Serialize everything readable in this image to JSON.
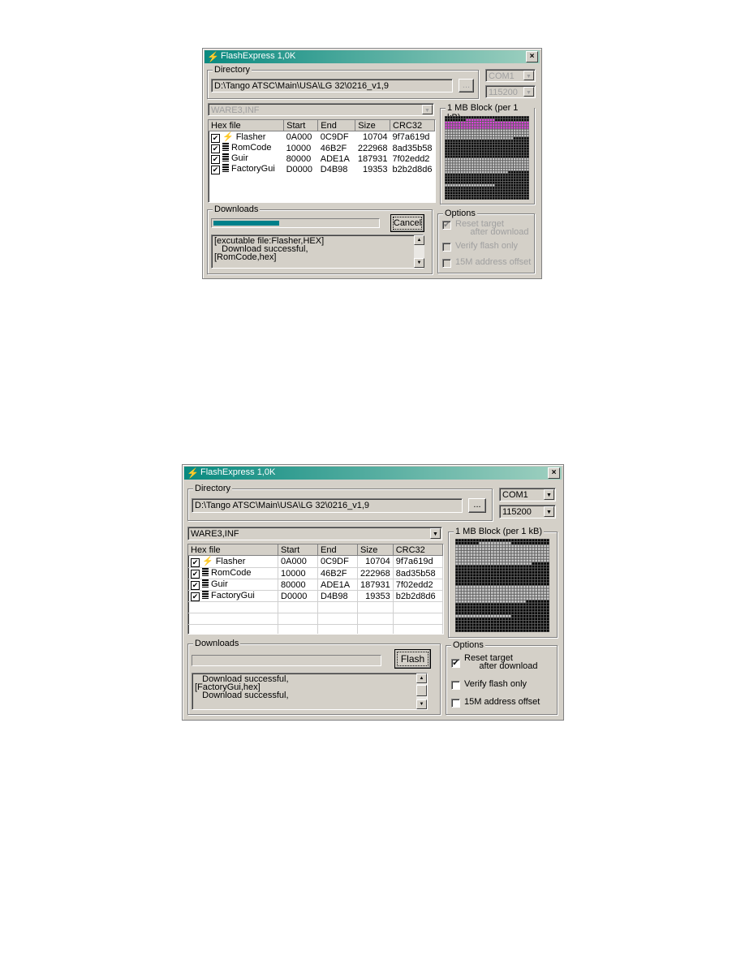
{
  "windows": [
    {
      "title": "FlashExpress 1,0K",
      "directory_label": "Directory",
      "directory_path": "D:\\Tango ATSC\\Main\\USA\\LG 32\\0216_v1,9",
      "browse_label": "...",
      "port": "COM1",
      "baud": "115200",
      "port_enabled": false,
      "inf_file": "WARE3,INF",
      "columns": [
        "Hex file",
        "Start",
        "End",
        "Size",
        "CRC32"
      ],
      "files": [
        {
          "name": "Flasher",
          "icon": "bolt-icon",
          "checked": true,
          "start": "0A000",
          "end": "0C9DF",
          "size": "10704",
          "crc": "9f7a619d"
        },
        {
          "name": "RomCode",
          "icon": "chip-icon",
          "checked": true,
          "start": "10000",
          "end": "46B2F",
          "size": "222968",
          "crc": "8ad35b58"
        },
        {
          "name": "Guir",
          "icon": "chip-icon",
          "checked": true,
          "start": "80000",
          "end": "ADE1A",
          "size": "187931",
          "crc": "7f02edd2"
        },
        {
          "name": "FactoryGui",
          "icon": "chip-icon",
          "checked": true,
          "start": "D0000",
          "end": "D4B98",
          "size": "19353",
          "crc": "b2b2d8d6"
        }
      ],
      "block_label": "1 MB Block (per 1 kB)",
      "downloads_label": "Downloads",
      "progress": 0.4,
      "action_button": "Cancel",
      "log": "[excutable file:Flasher,HEX]\n   Download successful,\n[RomCode,hex]",
      "options_label": "Options",
      "options": [
        {
          "label": "Reset target\n      after download",
          "checked": true
        },
        {
          "label": "Verify flash only",
          "checked": false
        },
        {
          "label": "15M address offset",
          "checked": false
        }
      ],
      "options_enabled": false,
      "accent_color": "#00808a",
      "highlight_color": "#e040e0"
    },
    {
      "title": "FlashExpress 1,0K",
      "directory_label": "Directory",
      "directory_path": "D:\\Tango ATSC\\Main\\USA\\LG 32\\0216_v1,9",
      "browse_label": "...",
      "port": "COM1",
      "baud": "115200",
      "port_enabled": true,
      "inf_file": "WARE3,INF",
      "columns": [
        "Hex file",
        "Start",
        "End",
        "Size",
        "CRC32"
      ],
      "files": [
        {
          "name": "Flasher",
          "icon": "bolt-icon",
          "checked": true,
          "start": "0A000",
          "end": "0C9DF",
          "size": "10704",
          "crc": "9f7a619d"
        },
        {
          "name": "RomCode",
          "icon": "chip-icon",
          "checked": true,
          "start": "10000",
          "end": "46B2F",
          "size": "222968",
          "crc": "8ad35b58"
        },
        {
          "name": "Guir",
          "icon": "chip-icon",
          "checked": true,
          "start": "80000",
          "end": "ADE1A",
          "size": "187931",
          "crc": "7f02edd2"
        },
        {
          "name": "FactoryGui",
          "icon": "chip-icon",
          "checked": true,
          "start": "D0000",
          "end": "D4B98",
          "size": "19353",
          "crc": "b2b2d8d6"
        }
      ],
      "block_label": "1 MB Block (per 1 kB)",
      "downloads_label": "Downloads",
      "progress": 0,
      "action_button": "Flash",
      "log": "   Download successful,\n[FactoryGui,hex]\n   Download successful,",
      "options_label": "Options",
      "options": [
        {
          "label": "Reset target\n      after download",
          "checked": true
        },
        {
          "label": "Verify flash only",
          "checked": false
        },
        {
          "label": "15M address offset",
          "checked": false
        }
      ],
      "options_enabled": true,
      "accent_color": "#00808a"
    }
  ]
}
